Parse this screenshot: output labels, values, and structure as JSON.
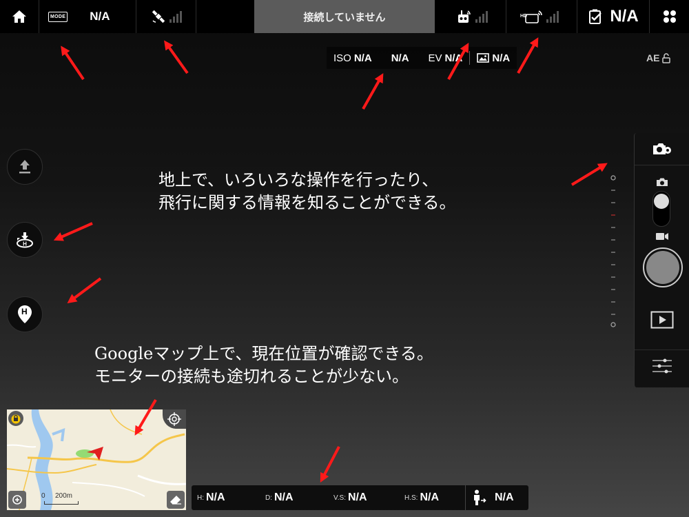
{
  "topbar": {
    "home_icon": "home-icon",
    "mode_badge": "MODE",
    "mode_value": "N/A",
    "gps_icon": "satellite-icon",
    "connection_status": "接続していません",
    "remote_icon": "remote-controller-icon",
    "hd_icon": "hd-video-link-icon",
    "hd_badge": "HD",
    "battery_icon": "battery-check-icon",
    "battery_value": "N/A",
    "menu_icon": "four-dots-menu-icon"
  },
  "camera": {
    "iso_label": "ISO",
    "iso_value": "N/A",
    "shutter_value": "N/A",
    "ev_label": "EV",
    "ev_value": "N/A",
    "image_format_icon": "image-icon",
    "image_format_value": "N/A",
    "ae_label": "AE",
    "ae_icon": "unlock-icon"
  },
  "left_buttons": {
    "takeoff_icon": "takeoff-icon",
    "return_home_icon": "return-to-home-icon",
    "home_point_icon": "home-point-pin-icon",
    "home_point_letter": "H"
  },
  "right_panel": {
    "camera_settings_icon": "camera-settings-icon",
    "photo_icon": "photo-camera-icon",
    "video_icon": "video-camera-icon",
    "shutter_icon": "shutter-button",
    "playback_icon": "playback-icon",
    "adjust_icon": "sliders-icon"
  },
  "annotations": {
    "top_line1": "地上で、いろいろな操作を行ったり、",
    "top_line2": "飛行に関する情報を知ることができる。",
    "bottom_line1": "Googleマップ上で、現在位置が確認できる。",
    "bottom_line2": "モニターの接続も途切れることが少ない。"
  },
  "map": {
    "lock_icon": "lock-icon",
    "locate_icon": "crosshair-icon",
    "zoom_icon": "zoom-in-icon",
    "eraser_icon": "eraser-icon",
    "scale_zero": "0",
    "scale_label": "200m",
    "aircraft_icon": "aircraft-arrow-icon"
  },
  "telemetry": {
    "h_label": "H:",
    "h_value": "N/A",
    "d_label": "D:",
    "d_value": "N/A",
    "vs_label": "V.S:",
    "vs_value": "N/A",
    "hs_label": "H.S:",
    "hs_value": "N/A",
    "pilot_icon": "pilot-distance-icon",
    "pilot_value": "N/A"
  },
  "colors": {
    "annotation_arrow": "#ff1a1a",
    "topbar_bg": "#000000",
    "connection_bar_bg": "#5b5b5b",
    "map_road": "#f5c64a",
    "map_river": "#9fc8ef",
    "lock_badge": "#f5c400",
    "aircraft": "#e02020"
  }
}
